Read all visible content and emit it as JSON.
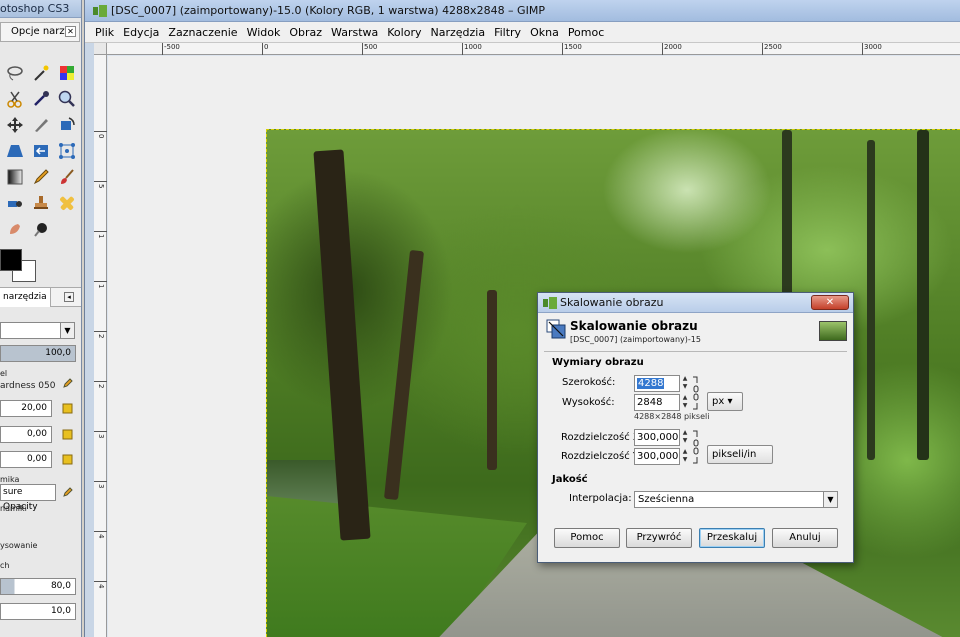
{
  "toolbox": {
    "title": "otoshop CS3",
    "tab_label": "Opcje narz...",
    "options_tab_label": "narzędzia",
    "opacity_value": "100,0",
    "brush_section": "el",
    "brush_name": "ardness 050",
    "size_value": "20,00",
    "aspect_value": "0,00",
    "angle_value": "0,00",
    "dynamics_label": "mika",
    "dynamics_name": "sure Opacity",
    "dynamics_opts": "namiki",
    "apply_label": "ysowanie",
    "jitter_label": "ch",
    "slider1_value": "80,0",
    "slider2_value": "10,0"
  },
  "main": {
    "title": "[DSC_0007] (zaimportowany)-15.0 (Kolory RGB, 1 warstwa) 4288x2848 – GIMP",
    "menu": [
      "Plik",
      "Edycja",
      "Zaznaczenie",
      "Widok",
      "Obraz",
      "Warstwa",
      "Kolory",
      "Narzędzia",
      "Filtry",
      "Okna",
      "Pomoc"
    ],
    "ruler_h": [
      "-500",
      "0",
      "500",
      "1000",
      "1500",
      "2000",
      "2500",
      "3000"
    ],
    "ruler_v": [
      "0",
      "5",
      "1",
      "1",
      "2",
      "2",
      "3",
      "3",
      "4",
      "4",
      "5",
      "5"
    ]
  },
  "dialog": {
    "title": "Skalowanie obrazu",
    "heading": "Skalowanie obrazu",
    "subheading": "[DSC_0007] (zaimportowany)-15",
    "section_size": "Wymiary obrazu",
    "width_label": "Szerokość:",
    "width_value": "4288",
    "height_label": "Wysokość:",
    "height_value": "2848",
    "size_unit": "px",
    "pixel_info": "4288×2848 pikseli",
    "res_x_label": "Rozdzielczość X:",
    "res_x_value": "300,000",
    "res_y_label": "Rozdzielczość Y:",
    "res_y_value": "300,000",
    "res_unit": "pikseli/in",
    "section_quality": "Jakość",
    "interp_label": "Interpolacja:",
    "interp_value": "Sześcienna",
    "btn_help": "Pomoc",
    "btn_reset": "Przywróć",
    "btn_scale": "Przeskaluj",
    "btn_cancel": "Anuluj",
    "close_glyph": "✕"
  },
  "colors": {
    "accent": "#3478d0",
    "selection_marching": "#d8d000",
    "close_red": "#c4402a"
  }
}
